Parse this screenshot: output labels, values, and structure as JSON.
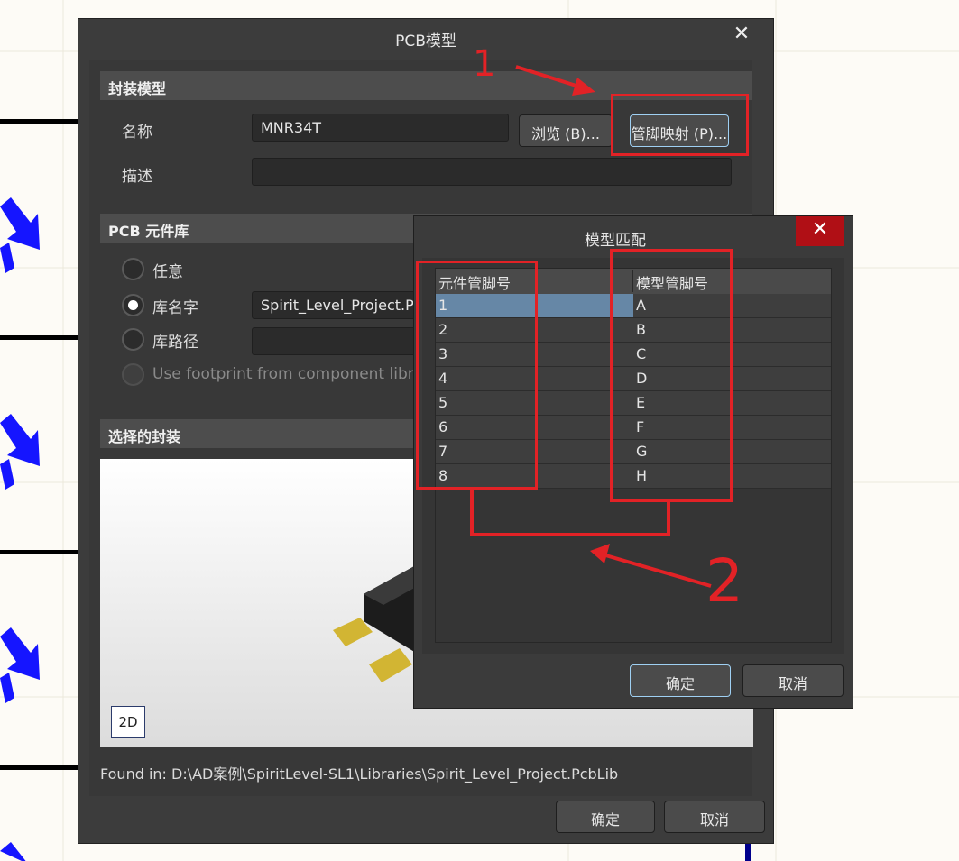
{
  "main_dialog": {
    "title": "PCB模型",
    "close_glyph": "✕",
    "footprint_section": "封装模型",
    "name_label": "名称",
    "name_value": "MNR34T",
    "browse_button": "浏览 (B)...",
    "pin_map_button": "管脚映射 (P)...",
    "desc_label": "描述",
    "desc_value": "",
    "library_section": "PCB 元件库",
    "radio_any": "任意",
    "radio_lib_name": "库名字",
    "lib_name_value": "Spirit_Level_Project.PcbLib",
    "radio_lib_path": "库路径",
    "lib_path_value": "",
    "radio_use_footprint": "Use footprint from component library",
    "selected_section": "选择的封装",
    "view_2d_button": "2D",
    "found_in": "Found in:   D:\\AD案例\\SpiritLevel-SL1\\Libraries\\Spirit_Level_Project.PcbLib",
    "ok_button": "确定",
    "cancel_button": "取消"
  },
  "pin_map_dialog": {
    "title": "模型匹配",
    "close_glyph": "✕",
    "columns": [
      "元件管脚号",
      "模型管脚号"
    ],
    "rows": [
      {
        "component_pin": "1",
        "model_pin": "A"
      },
      {
        "component_pin": "2",
        "model_pin": "B"
      },
      {
        "component_pin": "3",
        "model_pin": "C"
      },
      {
        "component_pin": "4",
        "model_pin": "D"
      },
      {
        "component_pin": "5",
        "model_pin": "E"
      },
      {
        "component_pin": "6",
        "model_pin": "F"
      },
      {
        "component_pin": "7",
        "model_pin": "G"
      },
      {
        "component_pin": "8",
        "model_pin": "H"
      }
    ],
    "selected_row": "1",
    "ok_button": "确定",
    "cancel_button": "取消"
  },
  "annotations": {
    "step_1": "1",
    "step_2": "2"
  },
  "colors": {
    "annotation_red": "#e22226",
    "close_button_red": "#b00f15",
    "selection_blue": "#6687a6",
    "net_blue": "#1515ff"
  }
}
